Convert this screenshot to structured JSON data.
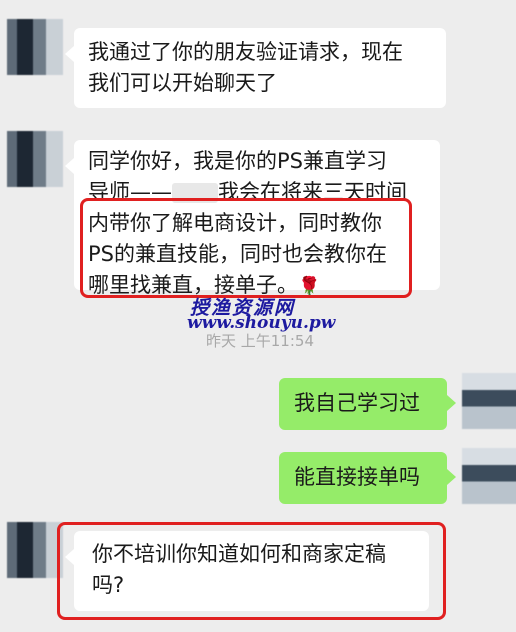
{
  "messages": [
    {
      "side": "left",
      "lines": [
        "我通过了你的朋友验证请求，现在",
        "我们可以开始聊天了"
      ]
    },
    {
      "side": "left",
      "lines_before_name": "同学你好，我是你的PS兼直学习",
      "line2_start": "导师——",
      "line2_end": "我会在将来三天时间",
      "lines": [
        "内带你了解电商设计，同时教你",
        "PS的兼直技能，同时也会教你在"
      ],
      "last_line": "哪里找兼直，接单子。",
      "emoji": "flower-icon"
    },
    {
      "side": "right",
      "text": "我自己学习过"
    },
    {
      "side": "right",
      "text": "能直接接单吗"
    },
    {
      "side": "left",
      "lines": [
        "你不培训你知道如何和商家定稿",
        "吗?"
      ]
    }
  ],
  "timestamp": "昨天 上午11:54",
  "watermark": {
    "cn": "授渔资源网",
    "url": "www.shouyu.pw"
  },
  "colors": {
    "background": "#ededed",
    "left_bubble": "#ffffff",
    "right_bubble": "#95ec69",
    "highlight_box": "#e02020",
    "watermark": "#1d1aa0"
  }
}
